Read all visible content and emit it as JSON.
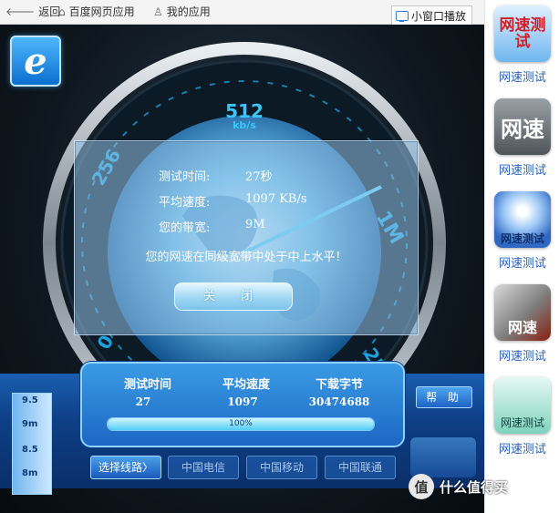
{
  "topbar": {
    "back": "返回",
    "baidu_apps": "百度网页应用",
    "my_apps": "我的应用",
    "small_window": "小窗口播放"
  },
  "logo": {
    "letter": "e"
  },
  "gauge": {
    "speed_value": "512",
    "speed_unit": "kb/s",
    "tick_left": "256",
    "tick_right": "1M",
    "tick_bottom_left": "0",
    "tick_bottom_right": "2M"
  },
  "dialog": {
    "rows": [
      {
        "label": "测试时间:",
        "value": "27秒"
      },
      {
        "label": "平均速度:",
        "value": "1097 KB/s"
      },
      {
        "label": "您的带宽:",
        "value": "9M"
      }
    ],
    "message": "您的网速在同级宽带中处于中上水平！",
    "close_label": "关 闭"
  },
  "ruler": {
    "ticks": [
      "9.5",
      "9m",
      "8.5",
      "8m"
    ]
  },
  "stats": {
    "headers": [
      "测试时间",
      "平均速度",
      "下载字节"
    ],
    "values": [
      "27",
      "1097",
      "30474688"
    ],
    "progress_fraction": 1.0,
    "progress_text": "100%"
  },
  "controls": {
    "help": "帮 助",
    "select_line": "选择线路〉",
    "isp": [
      "中国电信",
      "中国移动",
      "中国联通"
    ]
  },
  "sidebar": {
    "items": [
      {
        "label": "网速测试",
        "icon_text": "网速测试",
        "icon": "speedtest-text-icon",
        "color": "#6fb6f0"
      },
      {
        "label": "网速测试",
        "icon_text": "网速",
        "icon": "gauge-dial-icon",
        "color": "#6f7478"
      },
      {
        "label": "网速测试",
        "icon_text": "网速测试",
        "icon": "signal-waves-icon",
        "color": "#3a72c8"
      },
      {
        "label": "网速测试",
        "icon_text": "网速",
        "icon": "lightning-icon",
        "color": "#8a1f0e"
      },
      {
        "label": "网速测试",
        "icon_text": "网速测试",
        "icon": "stopwatch-icon",
        "color": "#7fd3bd"
      }
    ]
  },
  "watermark": {
    "text": "什么值得买",
    "badge": "值"
  }
}
